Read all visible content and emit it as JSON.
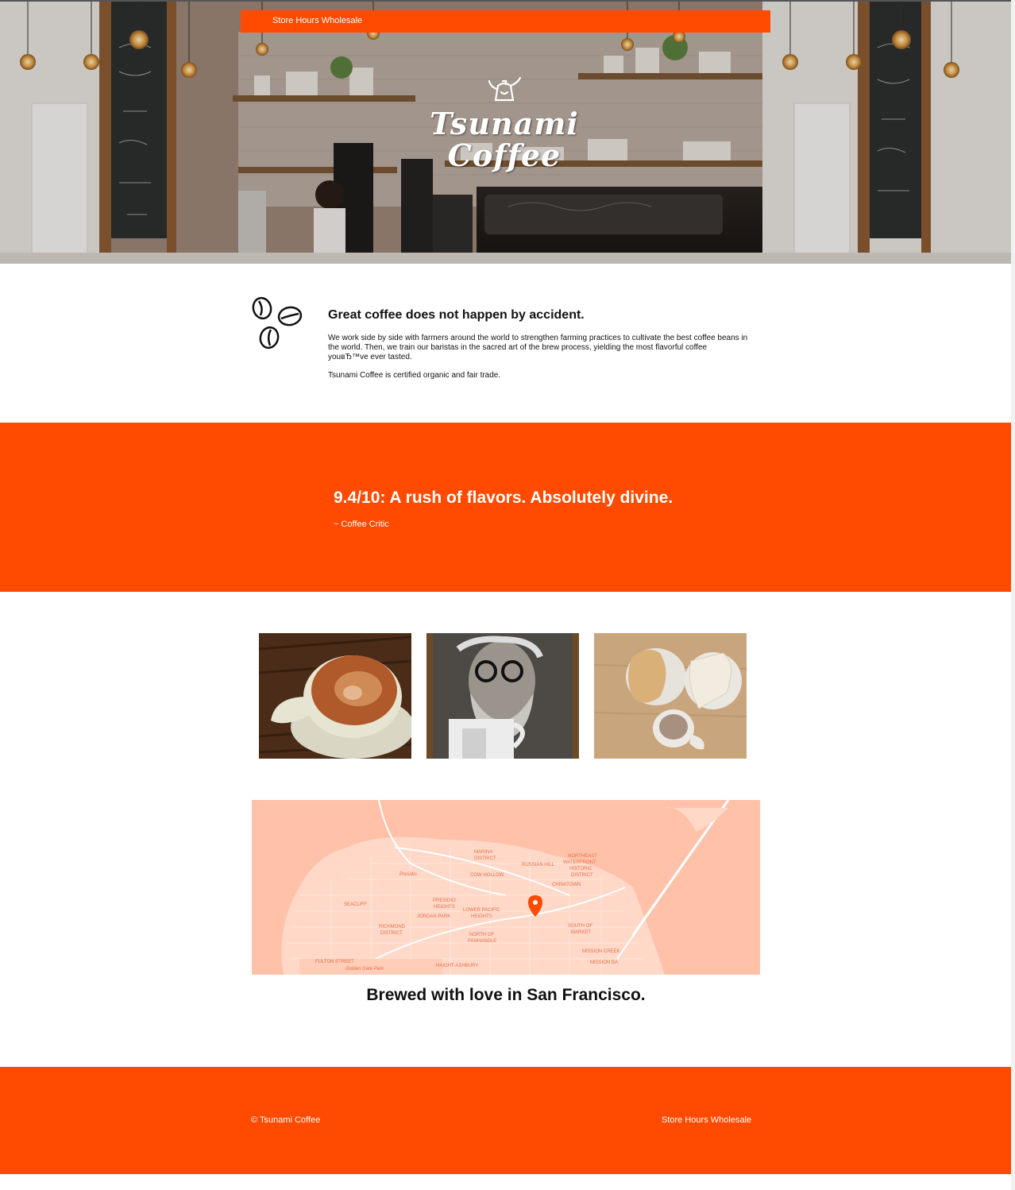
{
  "nav": {
    "items": [
      "Store Hours",
      "Wholesale"
    ]
  },
  "brand": {
    "name": "Tsunami Coffee",
    "logo_line1": "Tsunami",
    "logo_line2": "Coffee",
    "accent_color": "#ff4a00"
  },
  "about": {
    "heading": "Great coffee does not happen by accident.",
    "paragraph1": "We work side by side with farmers around the world to strengthen farming practices to cultivate the best coffee beans in the world. Then, we train our baristas in the sacred art of the brew process, yielding the most flavorful coffee youвЂ™ve ever tasted.",
    "paragraph2": "Tsunami Coffee is certified organic and fair trade."
  },
  "review": {
    "quote": "9.4/10: A rush of flavors. Absolutely divine.",
    "cite": "~ Coffee Critic"
  },
  "map": {
    "labels": [
      "MARINA DISTRICT",
      "RUSSIAN HILL",
      "NORTHEAST WATERFRONT HISTORIC DISTRICT",
      "Presidio",
      "COW HOLLOW",
      "CHINATOWN",
      "SEACLIFF",
      "PRESIDIO HEIGHTS",
      "LOWER PACIFIC HEIGHTS",
      "JORDAN PARK",
      "RICHMOND DISTRICT",
      "NORTH OF PANHANDLE",
      "SOUTH OF MARKET",
      "MISSION CREEK",
      "HAIGHT-ASHBURY",
      "FULTON STREET",
      "Golden Gate Park",
      "MISSION BA"
    ]
  },
  "location": {
    "tagline": "Brewed with love in San Francisco."
  },
  "footer": {
    "copyright": "© Tsunami Coffee",
    "links": [
      "Store Hours",
      "Wholesale"
    ]
  }
}
